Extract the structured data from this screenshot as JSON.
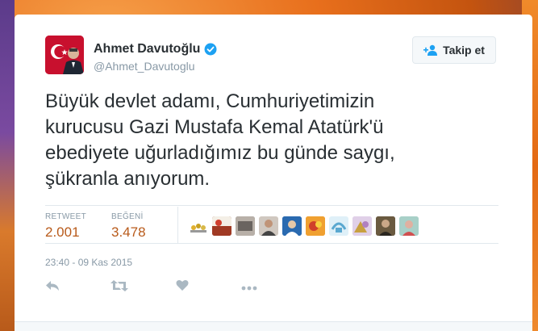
{
  "user": {
    "name": "Ahmet Davutoğlu",
    "handle": "@Ahmet_Davutoglu",
    "verified": true
  },
  "follow_button": {
    "label": "Takip et",
    "icon": "add-user-icon"
  },
  "tweet": {
    "text": "Büyük devlet adamı, Cumhuriyetimizin\nkurucusu Gazi Mustafa Kemal Atatürk'ü\nebediyete uğurladığımız bu günde saygı,\nşükranla anıyorum."
  },
  "stats": {
    "retweets_label": "RETWEET",
    "retweets_value": "2.001",
    "likes_label": "BEĞENİ",
    "likes_value": "3.478"
  },
  "likers_count_shown": 9,
  "timestamp": "23:40 - 09 Kas 2015",
  "actions": [
    "reply-icon",
    "retweet-icon",
    "like-icon",
    "more-icon"
  ],
  "colors": {
    "stat_value": "#b85a1a",
    "verified": "#1da1f2",
    "icon_gray": "#aab8c2"
  }
}
